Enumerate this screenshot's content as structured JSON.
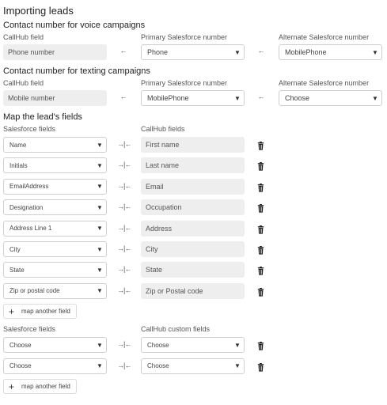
{
  "title": "Importing leads",
  "voice": {
    "heading": "Contact number for voice campaigns",
    "col_callhub": "CallHub field",
    "col_primary": "Primary Salesforce number",
    "col_alternate": "Alternate Salesforce number",
    "callhub_value": "Phone number",
    "primary_value": "Phone",
    "alternate_value": "MobilePhone"
  },
  "texting": {
    "heading": "Contact number for texting campaigns",
    "col_callhub": "CallHub field",
    "col_primary": "Primary Salesforce number",
    "col_alternate": "Alternate Salesforce number",
    "callhub_value": "Mobile number",
    "primary_value": "MobilePhone",
    "alternate_value": "Choose"
  },
  "mapping": {
    "heading": "Map the lead's fields",
    "col_salesforce": "Salesforce fields",
    "col_callhub": "CallHub fields",
    "rows": [
      {
        "salesforce": "Name",
        "callhub": "First name"
      },
      {
        "salesforce": "Initials",
        "callhub": "Last name"
      },
      {
        "salesforce": "EmailAddress",
        "callhub": "Email"
      },
      {
        "salesforce": "Designation",
        "callhub": "Occupation"
      },
      {
        "salesforce": "Address Line 1",
        "callhub": "Address"
      },
      {
        "salesforce": "City",
        "callhub": "City"
      },
      {
        "salesforce": "State",
        "callhub": "State"
      },
      {
        "salesforce": "Zip or postal code",
        "callhub": "Zip or Postal code"
      }
    ],
    "add_label": "map another field"
  },
  "custom": {
    "col_salesforce": "Salesforce fields",
    "col_callhub": "CallHub custom fields",
    "rows": [
      {
        "salesforce": "Choose",
        "callhub": "Choose"
      },
      {
        "salesforce": "Choose",
        "callhub": "Choose"
      }
    ],
    "add_label": "map another field"
  },
  "icons": {
    "left_arrow": "left-arrow-icon",
    "map": "map-arrows-icon",
    "trash": "trash-icon",
    "caret": "caret-down-icon",
    "plus": "plus-icon"
  }
}
